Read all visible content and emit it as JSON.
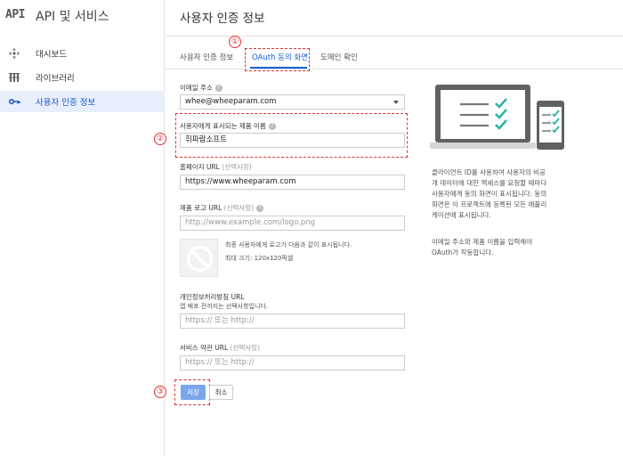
{
  "brand": {
    "logo": "API",
    "title": "API 및 서비스"
  },
  "sidebar": {
    "items": [
      {
        "label": "대시보드",
        "icon": "dashboard-icon"
      },
      {
        "label": "라이브러리",
        "icon": "library-icon"
      },
      {
        "label": "사용자 인증 정보",
        "icon": "key-icon",
        "active": true
      }
    ]
  },
  "page": {
    "title": "사용자 인증 정보"
  },
  "tabs": [
    {
      "label": "사용자 인증 정보"
    },
    {
      "label": "OAuth 동의 화면",
      "active": true
    },
    {
      "label": "도메인 확인"
    }
  ],
  "annotations": {
    "one": "①",
    "two": "②",
    "three": "③"
  },
  "form": {
    "email_label": "이메일 주소",
    "email_value": "whee@wheeparam.com",
    "product_label": "사용자에게 표시되는 제품 이름",
    "product_value": "휘파람소프트",
    "homepage_label": "홈페이지 URL",
    "homepage_optional": "(선택사항)",
    "homepage_value": "https://www.wheeparam.com",
    "logo_label": "제품 로고 URL",
    "logo_optional": "(선택사항)",
    "logo_placeholder": "http://www.example.com/logo.png",
    "logo_note1": "최종 사용자에게 로고가 다음과 같이 표시됩니다.",
    "logo_note2": "최대 크기: 120x120픽셀",
    "privacy_label": "개인정보처리방침 URL",
    "privacy_sub": "앱 배포 전까지는 선택사항입니다.",
    "privacy_placeholder": "https:// 또는 http://",
    "terms_label": "서비스 약관 URL",
    "terms_optional": "(선택사항)",
    "terms_placeholder": "https:// 또는 http://",
    "save_label": "저장",
    "cancel_label": "취소"
  },
  "info": {
    "para1": "클라이언트 ID를 사용하여 사용자의 비공\n개 데이터에 대한 액세스를 요청할 때마다\n사용자에게 동의 화면이 표시됩니다. 동의\n화면은 이 프로젝트에 등록된 모든 애플리\n케이션에 표시됩니다.",
    "para2": "이메일 주소와 제품 이름을 입력해야\nOAuth가 작동합니다."
  },
  "colors": {
    "accent": "#1a62d6",
    "annotation": "#dd3333",
    "check": "#2bb3a3",
    "save": "#7aa7ea"
  }
}
